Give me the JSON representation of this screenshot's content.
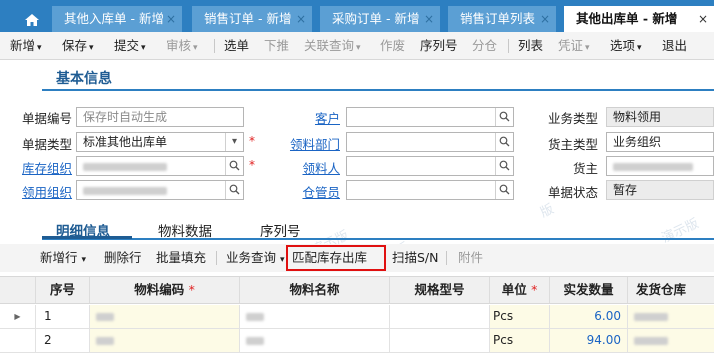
{
  "tabs": [
    {
      "label": "其他入库单 - 新增",
      "close": "×",
      "active": false
    },
    {
      "label": "销售订单 - 新增",
      "close": "×",
      "active": false
    },
    {
      "label": "采购订单 - 新增",
      "close": "×",
      "active": false
    },
    {
      "label": "销售订单列表",
      "close": "×",
      "active": false
    },
    {
      "label": "其他出库单 - 新增",
      "close": "×",
      "active": true
    }
  ],
  "toolbar": {
    "new": "新增",
    "save": "保存",
    "submit": "提交",
    "audit": "审核",
    "select": "选单",
    "push": "下推",
    "related": "关联查询",
    "void": "作废",
    "serial": "序列号",
    "split": "分仓",
    "list": "列表",
    "voucher": "凭证",
    "options": "选项",
    "exit": "退出"
  },
  "section_title": "基本信息",
  "form": {
    "bill_no_label": "单据编号",
    "bill_no_placeholder": "保存时自动生成",
    "bill_type_label": "单据类型",
    "bill_type_value": "标准其他出库单",
    "stock_org_label": "库存组织",
    "use_org_label": "领用组织",
    "customer_label": "客户",
    "dept_label": "领料部门",
    "picker_label": "领料人",
    "keeper_label": "仓管员",
    "biz_type_label": "业务类型",
    "biz_type_value": "物料领用",
    "owner_type_label": "货主类型",
    "owner_type_value": "业务组织",
    "owner_label": "货主",
    "status_label": "单据状态",
    "status_value": "暂存"
  },
  "watermarks": [
    "演示版",
    "演示版",
    "版",
    "演示版"
  ],
  "detail_tabs": {
    "detail": "明细信息",
    "material": "物料数据",
    "serial": "序列号"
  },
  "grid_toolbar": {
    "add_row": "新增行",
    "delete_row": "删除行",
    "batch_fill": "批量填充",
    "biz_query": "业务查询",
    "match_stock": "匹配库存出库",
    "scan": "扫描S/N",
    "attach": "附件"
  },
  "table": {
    "headers": {
      "seq": "序号",
      "code": "物料编码",
      "name": "物料名称",
      "spec": "规格型号",
      "unit": "单位",
      "qty": "实发数量",
      "warehouse": "发货仓库"
    },
    "required_mark": "*",
    "rows": [
      {
        "seq": "1",
        "unit": "Pcs",
        "qty": "6.00"
      },
      {
        "seq": "2",
        "unit": "Pcs",
        "qty": "94.00"
      }
    ]
  }
}
